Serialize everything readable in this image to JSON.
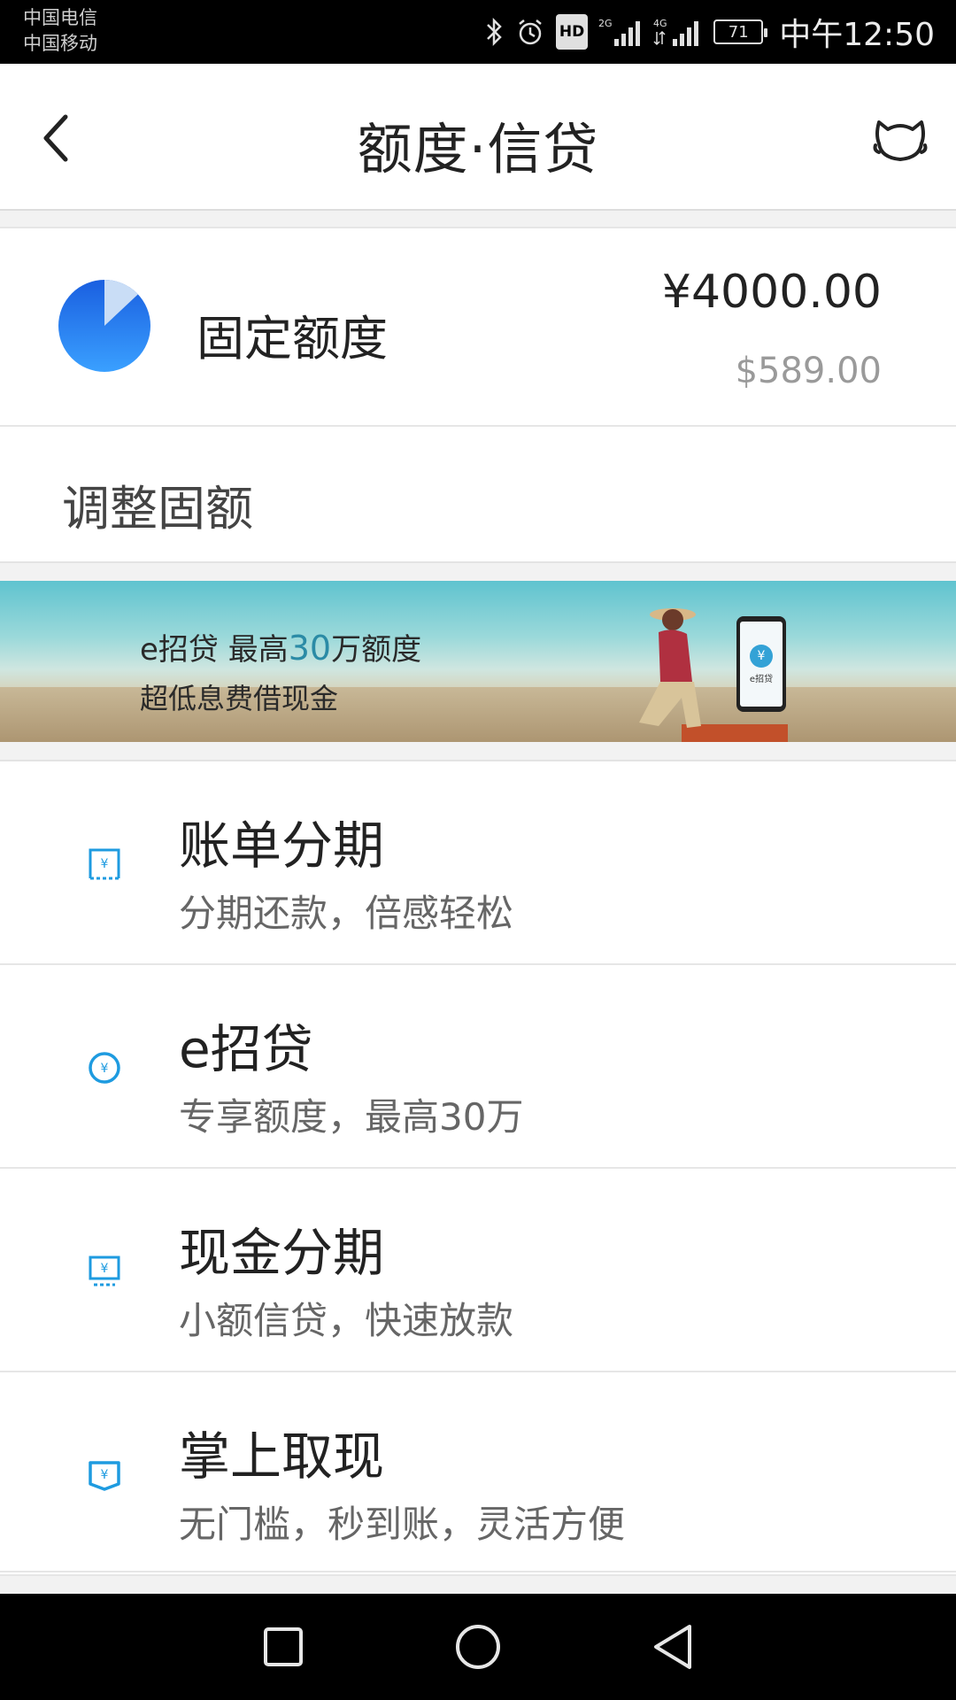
{
  "status_bar": {
    "carrier_1": "中国电信",
    "carrier_2": "中国移动",
    "network_2g": "2G",
    "network_4g": "4G",
    "hd": "HD",
    "battery": "71",
    "time": "中午12:50"
  },
  "header": {
    "title": "额度·信贷"
  },
  "quota": {
    "label": "固定额度",
    "total": "¥4000.00",
    "usd": "$589.00",
    "used_fraction": 0.13
  },
  "adjust": {
    "label": "调整固额"
  },
  "banner": {
    "line1_prefix": "e招贷  最高",
    "line1_accent": "30",
    "line1_suffix": "万额度",
    "line2": "超低息费借现金",
    "phone_text": "e招贷"
  },
  "services": [
    {
      "title": "账单分期",
      "subtitle": "分期还款，倍感轻松",
      "icon": "bill-installment-icon"
    },
    {
      "title": "e招贷",
      "subtitle": "专享额度，最高30万",
      "icon": "e-loan-icon"
    },
    {
      "title": "现金分期",
      "subtitle": "小额信贷，快速放款",
      "icon": "cash-installment-icon"
    },
    {
      "title": "掌上取现",
      "subtitle": "无门槛，秒到账，灵活方便",
      "icon": "mobile-cash-icon"
    }
  ],
  "colors": {
    "accent": "#1e9be0",
    "pie_dark": "#1565e0",
    "pie_light": "#c9ddf6"
  }
}
